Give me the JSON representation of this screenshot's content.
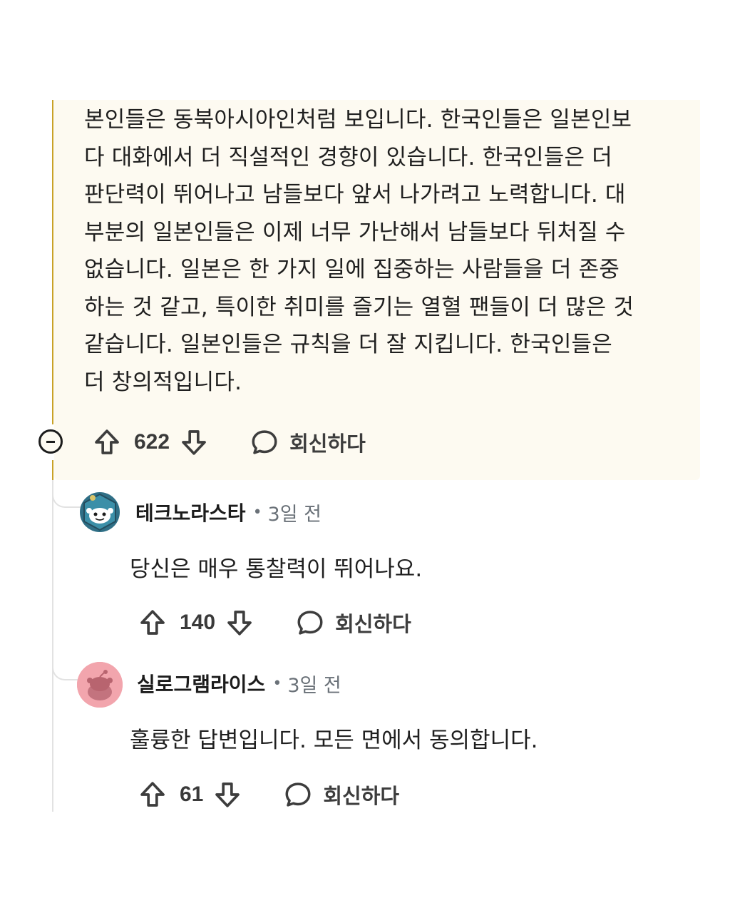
{
  "parent": {
    "lines": [
      "본인들은 동북아시아인처럼 보입니다. 한국인들은 일본인보",
      "다 대화에서 더 직설적인 경향이 있습니다. 한국인들은 더",
      "판단력이 뛰어나고 남들보다 앞서 나가려고 노력합니다. 대",
      "부분의 일본인들은 이제 너무 가난해서 남들보다 뒤처질 수",
      "없습니다. 일본은 한 가지 일에 집중하는 사람들을 더 존중",
      "하는 것 같고, 특이한 취미를 즐기는 열혈 팬들이 더 많은 것",
      "같습니다. 일본인들은 규칙을 더 잘 지킵니다. 한국인들은",
      "더 창의적입니다."
    ],
    "score": "622",
    "reply_label": "회신하다"
  },
  "replies": [
    {
      "username": "테크노라스타",
      "separator": "•",
      "time": "3일 전",
      "body": "당신은 매우 통찰력이 뛰어나요.",
      "score": "140",
      "reply_label": "회신하다",
      "avatar_color": "#2f6f86"
    },
    {
      "username": "실로그램라이스",
      "separator": "•",
      "time": "3일 전",
      "body": "훌륭한 답변입니다. 모든 면에서 동의합니다.",
      "score": "61",
      "reply_label": "회신하다",
      "avatar_color": "#f2a5ad"
    }
  ],
  "colors": {
    "highlight_bg": "#fdfaf1",
    "thread_gold": "#c9a227",
    "thread_grey": "#e2e2e2",
    "meta_grey": "#6a7178"
  }
}
